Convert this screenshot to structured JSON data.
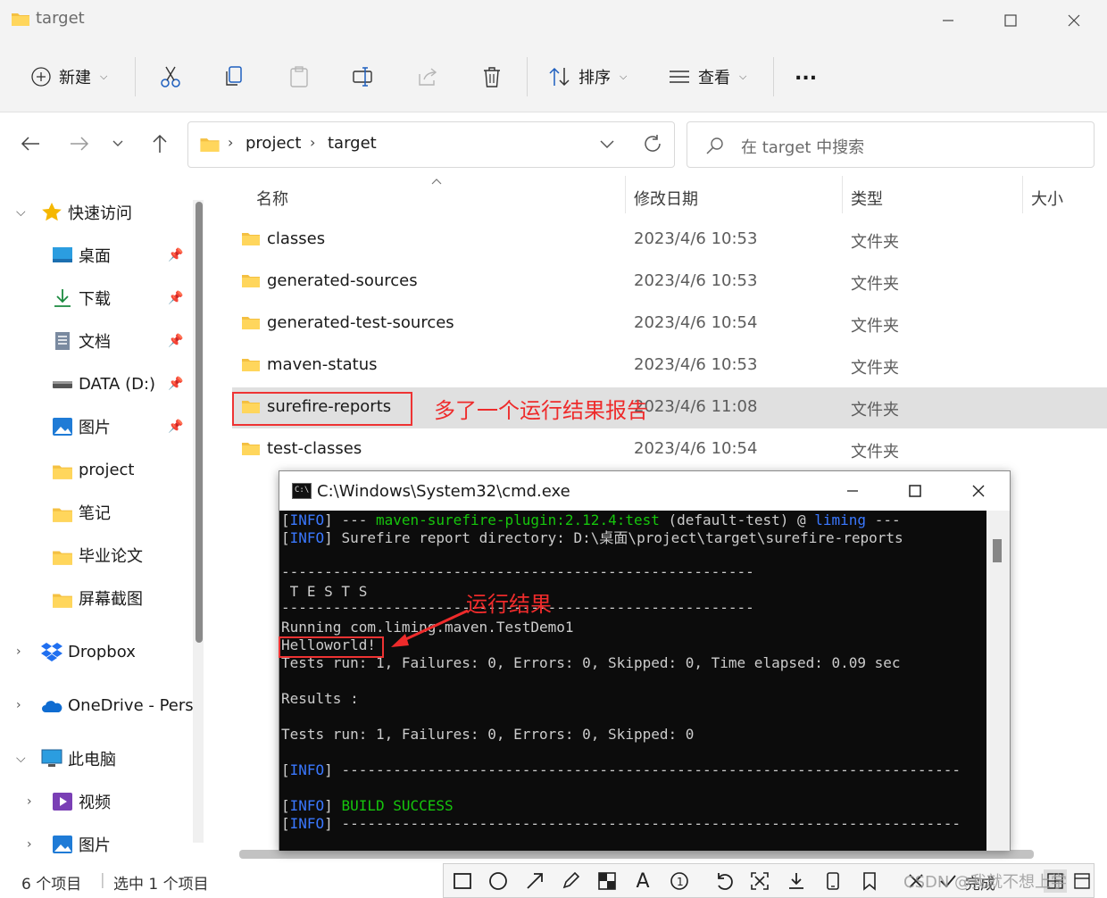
{
  "window": {
    "title": "target"
  },
  "toolbar": {
    "new_label": "新建",
    "sort_label": "排序",
    "view_label": "查看",
    "more_label": "..."
  },
  "address": {
    "crumbs": [
      "project",
      "target"
    ]
  },
  "search": {
    "placeholder": "在 target 中搜索"
  },
  "nav": {
    "quick_access": "快速访问",
    "items": [
      {
        "label": "桌面",
        "icon": "desktop-icon",
        "pinned": true
      },
      {
        "label": "下载",
        "icon": "download-icon",
        "pinned": true
      },
      {
        "label": "文档",
        "icon": "document-icon",
        "pinned": true
      },
      {
        "label": "DATA (D:)",
        "icon": "drive-icon",
        "pinned": true
      },
      {
        "label": "图片",
        "icon": "pictures-icon",
        "pinned": true
      },
      {
        "label": "project",
        "icon": "folder-icon",
        "pinned": false
      },
      {
        "label": "笔记",
        "icon": "folder-icon",
        "pinned": false
      },
      {
        "label": "毕业论文",
        "icon": "folder-icon",
        "pinned": false
      },
      {
        "label": "屏幕截图",
        "icon": "folder-icon",
        "pinned": false
      }
    ],
    "dropbox": "Dropbox",
    "onedrive": "OneDrive - Pers",
    "this_pc": "此电脑",
    "videos": "视频",
    "pictures": "图片"
  },
  "columns": {
    "name": "名称",
    "date": "修改日期",
    "type": "类型",
    "size": "大小"
  },
  "files": [
    {
      "name": "classes",
      "date": "2023/4/6 10:53",
      "type": "文件夹"
    },
    {
      "name": "generated-sources",
      "date": "2023/4/6 10:53",
      "type": "文件夹"
    },
    {
      "name": "generated-test-sources",
      "date": "2023/4/6 10:54",
      "type": "文件夹"
    },
    {
      "name": "maven-status",
      "date": "2023/4/6 10:53",
      "type": "文件夹"
    },
    {
      "name": "surefire-reports",
      "date": "2023/4/6 11:08",
      "type": "文件夹"
    },
    {
      "name": "test-classes",
      "date": "2023/4/6 10:54",
      "type": "文件夹"
    }
  ],
  "annotations": {
    "folder_note": "多了一个运行结果报告",
    "cmd_note": "运行结果"
  },
  "status": {
    "count": "6 个项目",
    "selected": "选中 1 个项目"
  },
  "cmd": {
    "title": "C:\\Windows\\System32\\cmd.exe",
    "info": "INFO",
    "l1_mid": " --- ",
    "l1_plugin": "maven-surefire-plugin:2.12.4:test",
    "l1_rest": " (default-test) @ ",
    "l1_proj": "liming",
    "l1_end": " ---",
    "l2_rest": " Surefire report directory: D:\\桌面\\project\\target\\surefire-reports",
    "l3": "-------------------------------------------------------",
    "l4": " T E S T S",
    "l5": "-------------------------------------------------------",
    "l6": "Running com.liming.maven.TestDemo1",
    "l7": "Helloworld!",
    "l8": "Tests run: 1, Failures: 0, Errors: 0, Skipped: 0, Time elapsed: 0.09 sec",
    "l9": "Results :",
    "l10": "Tests run: 1, Failures: 0, Errors: 0, Skipped: 0",
    "l11_rest": " ------------------------------------------------------------------------",
    "l12_rest": "BUILD SUCCESS",
    "l13_rest": " ------------------------------------------------------------------------"
  },
  "snip": {
    "done_label": "完成"
  },
  "watermark": "CSDN @我就不想上学",
  "colors": {
    "annotation_red": "#ee2b2b",
    "cmd_blue": "#3a78ff",
    "cmd_green": "#16c60c",
    "selection_gray": "#e0e0e0"
  }
}
